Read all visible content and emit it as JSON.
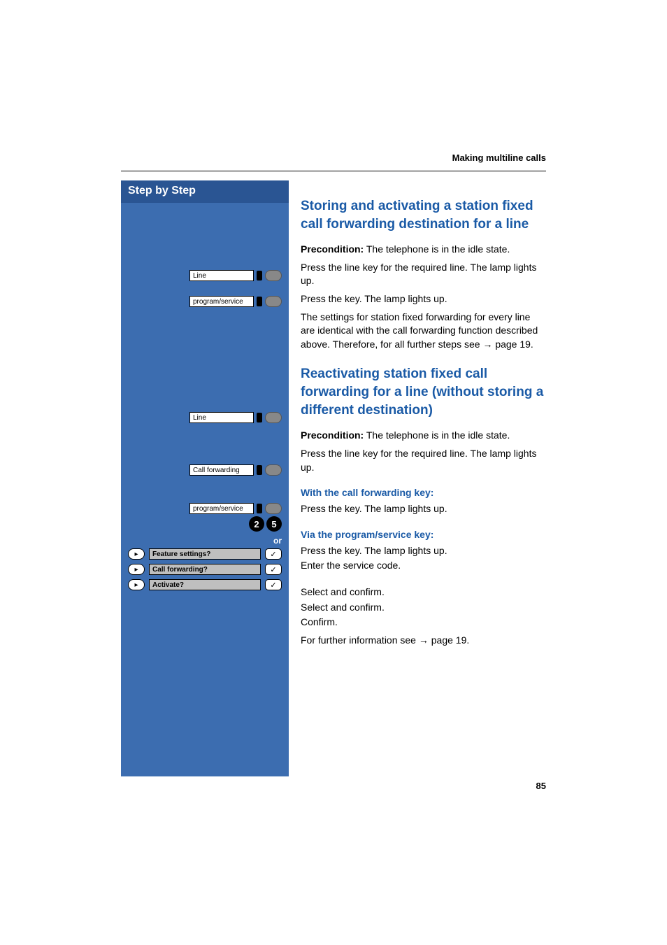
{
  "header": {
    "running_head": "Making multiline calls"
  },
  "sidebar": {
    "title": "Step by Step",
    "keys": {
      "line": "Line",
      "program_service": "program/service",
      "call_forwarding": "Call forwarding"
    },
    "or_label": "or",
    "code_digits": [
      "2",
      "5"
    ],
    "menu": {
      "feature_settings": "Feature settings?",
      "call_forwarding_q": "Call forwarding?",
      "activate_q": "Activate?"
    }
  },
  "main": {
    "section1": {
      "heading": "Storing and activating a station fixed call forwarding destination for a line",
      "precondition_label": "Precondition:",
      "precondition_text": " The telephone is in the idle state.",
      "p_line": "Press the line key for the required line. The lamp lights up.",
      "p_ps": "Press the key. The lamp lights up.",
      "p_same": "The settings for station fixed forwarding for every line are identical with the call forwarding function described above. Therefore, for all further steps see ",
      "p_same_link": " page 19."
    },
    "section2": {
      "heading": "Reactivating station fixed call forwarding for a line (without storing a different destination)",
      "precondition_label": "Precondition:",
      "precondition_text": " The telephone is in the idle state.",
      "p_line": "Press the line key for the required line. The lamp lights up.",
      "sub1_heading": "With the call forwarding key:",
      "sub1_p": "Press the key. The lamp lights up.",
      "sub2_heading": "Via the program/service key:",
      "sub2_p1": "Press the key. The lamp lights up.",
      "sub2_p2": "Enter the service code.",
      "menu_p1": "Select and confirm.",
      "menu_p2": "Select and confirm.",
      "menu_p3": "Confirm.",
      "further_info_a": "For further information see ",
      "further_info_b": " page 19."
    }
  },
  "footer": {
    "page_number": "85"
  }
}
